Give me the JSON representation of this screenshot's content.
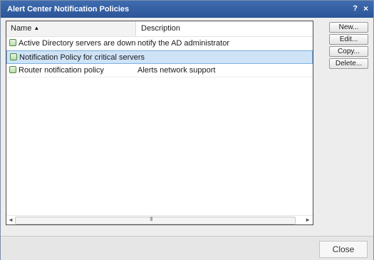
{
  "window": {
    "title": "Alert Center Notification Policies",
    "help_glyph": "?",
    "close_glyph": "×"
  },
  "table": {
    "columns": [
      {
        "label": "Name",
        "sort": "ascending"
      },
      {
        "label": "Description"
      }
    ],
    "rows": [
      {
        "name": "Active Directory servers are down",
        "description": "notify the AD administrator",
        "selected": false
      },
      {
        "name": "Notification Policy for critical servers",
        "description": "",
        "selected": true
      },
      {
        "name": "Router notification policy",
        "description": "Alerts network support",
        "selected": false
      }
    ],
    "sort_arrow": "▲",
    "scroll_left": "◄",
    "scroll_right": "►",
    "scroll_grip": "III"
  },
  "buttons": {
    "new": "New...",
    "edit": "Edit...",
    "copy": "Copy...",
    "delete": "Delete..."
  },
  "footer": {
    "close": "Close"
  }
}
